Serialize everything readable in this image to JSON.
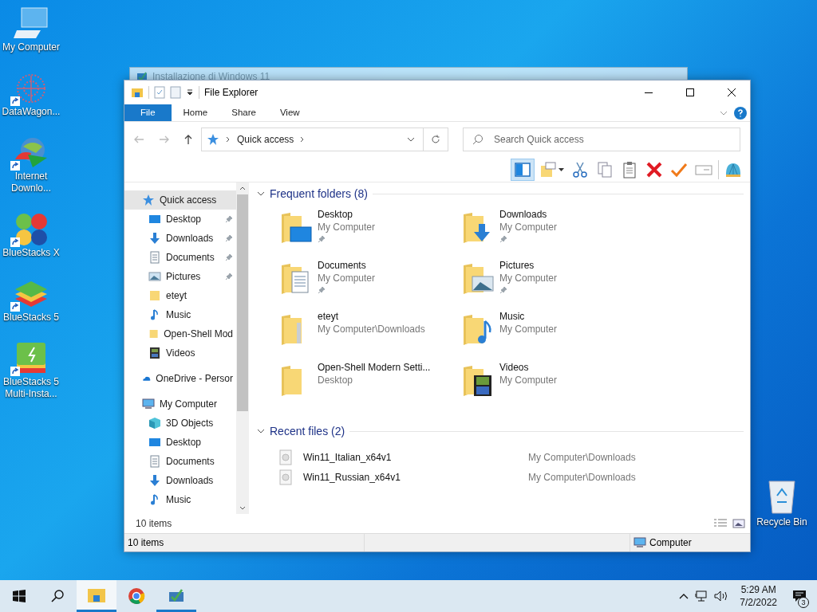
{
  "desktop_icons": [
    {
      "label": "My Computer",
      "kind": "computer"
    },
    {
      "label": "DataWagon...",
      "kind": "datawagon"
    },
    {
      "label": "Internet Downlo...",
      "kind": "idm"
    },
    {
      "label": "BlueStacks X",
      "kind": "bsx"
    },
    {
      "label": "BlueStacks 5",
      "kind": "bs5"
    },
    {
      "label": "BlueStacks 5 Multi-Insta...",
      "kind": "bsm"
    }
  ],
  "recycle_bin": {
    "label": "Recycle Bin"
  },
  "background_window": {
    "title": "Installazione di Windows 11"
  },
  "explorer": {
    "title": "File Explorer",
    "ribbon_tabs": [
      {
        "label": "File",
        "selected": true
      },
      {
        "label": "Home",
        "selected": false
      },
      {
        "label": "Share",
        "selected": false
      },
      {
        "label": "View",
        "selected": false
      }
    ],
    "address": "Quick access",
    "search_placeholder": "Search Quick access",
    "toolbar": [
      {
        "kind": "pane",
        "selected": true
      },
      {
        "kind": "props",
        "selected": false
      },
      {
        "kind": "cut",
        "selected": false
      },
      {
        "kind": "copy",
        "selected": false
      },
      {
        "kind": "paste",
        "selected": false
      },
      {
        "kind": "delete",
        "selected": false
      },
      {
        "kind": "check",
        "selected": false
      },
      {
        "kind": "rename",
        "selected": false
      },
      {
        "kind": "shell",
        "selected": false
      }
    ],
    "nav": [
      {
        "label": "Quick access",
        "kind": "star",
        "selected": true,
        "children": [
          {
            "label": "Desktop",
            "kind": "desktop",
            "pinned": true,
            "selected": false
          },
          {
            "label": "Downloads",
            "kind": "downloads",
            "pinned": true,
            "selected": false
          },
          {
            "label": "Documents",
            "kind": "documents",
            "pinned": true,
            "selected": false
          },
          {
            "label": "Pictures",
            "kind": "pictures",
            "pinned": true,
            "selected": false
          },
          {
            "label": "eteyt",
            "kind": "folder",
            "pinned": false,
            "selected": false
          },
          {
            "label": "Music",
            "kind": "music",
            "pinned": false,
            "selected": false
          },
          {
            "label": "Open-Shell Mod",
            "kind": "folder",
            "pinned": false,
            "selected": false
          },
          {
            "label": "Videos",
            "kind": "videos",
            "pinned": false,
            "selected": false
          }
        ]
      },
      {
        "label": "OneDrive - Persor",
        "kind": "cloud",
        "selected": false
      },
      {
        "label": "My Computer",
        "kind": "computer",
        "selected": false,
        "children": [
          {
            "label": "3D Objects",
            "kind": "objects",
            "pinned": false,
            "selected": false
          },
          {
            "label": "Desktop",
            "kind": "desktop",
            "pinned": false,
            "selected": false
          },
          {
            "label": "Documents",
            "kind": "documents",
            "pinned": false,
            "selected": false
          },
          {
            "label": "Downloads",
            "kind": "downloads",
            "pinned": false,
            "selected": false
          },
          {
            "label": "Music",
            "kind": "music",
            "pinned": false,
            "selected": false
          }
        ]
      }
    ],
    "frequent_title": "Frequent folders (8)",
    "folders": [
      {
        "name": "Desktop",
        "location": "My Computer",
        "pinned": true,
        "kind": "desktop"
      },
      {
        "name": "Downloads",
        "location": "My Computer",
        "pinned": true,
        "kind": "downloads"
      },
      {
        "name": "Documents",
        "location": "My Computer",
        "pinned": true,
        "kind": "documents"
      },
      {
        "name": "Pictures",
        "location": "My Computer",
        "pinned": true,
        "kind": "pictures"
      },
      {
        "name": "eteyt",
        "location": "My Computer\\Downloads",
        "pinned": false,
        "kind": "zip"
      },
      {
        "name": "Music",
        "location": "My Computer",
        "pinned": false,
        "kind": "music"
      },
      {
        "name": "Open-Shell Modern Setti...",
        "location": "Desktop",
        "pinned": false,
        "kind": "folder"
      },
      {
        "name": "Videos",
        "location": "My Computer",
        "pinned": false,
        "kind": "videos"
      }
    ],
    "recent_title": "Recent files (2)",
    "recent": [
      {
        "name": "Win11_Italian_x64v1",
        "location": "My Computer\\Downloads"
      },
      {
        "name": "Win11_Russian_x64v1",
        "location": "My Computer\\Downloads"
      }
    ],
    "view_count": "10 items",
    "status_left": "10 items",
    "status_right": "Computer"
  },
  "taskbar": {
    "apps": [
      {
        "kind": "explorer",
        "active": true,
        "running": true
      },
      {
        "kind": "chrome",
        "active": false,
        "running": false
      },
      {
        "kind": "setup",
        "active": false,
        "running": true
      }
    ],
    "time": "5:29 AM",
    "date": "7/2/2022",
    "notifications": "3"
  }
}
